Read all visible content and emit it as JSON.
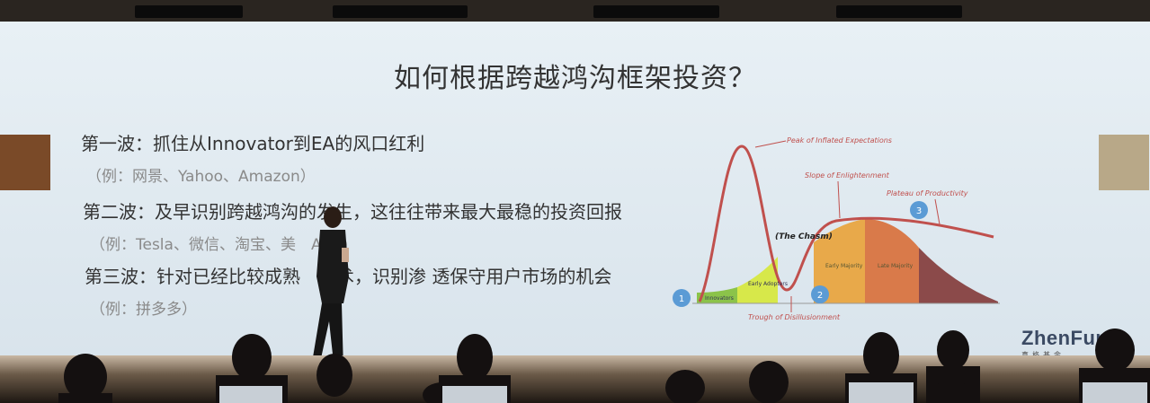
{
  "slide": {
    "title": "如何根据跨越鸿沟框架投资？",
    "waves": [
      {
        "text": "第一波：抓住从Innovator到EA的风口红利",
        "example": "（例：网景、Yahoo、Amazon）"
      },
      {
        "text": "第二波：及早识别跨越鸿沟的发生，这往往带来最大最稳的投资回报",
        "example": "（例：Tesla、微信、淘宝、美　AAS)"
      },
      {
        "text": "第三波：针对已经比较成熟　技术，识别渗 透保守用户市场的机会",
        "example": "（例：拼多多）"
      }
    ]
  },
  "chart": {
    "annotations": {
      "peak": "Peak of Inflated Expectations",
      "slope": "Slope of Enlightenment",
      "plateau": "Plateau of Productivity",
      "chasm": "(The Chasm)",
      "trough": "Trough of Disillusionment"
    },
    "segments": {
      "innovators": "Innovators",
      "early_adopters": "Early Adopters",
      "early_majority": "Early Majority",
      "late_majority": "Late Majority"
    },
    "markers": [
      "1",
      "2",
      "3"
    ]
  },
  "logo": {
    "name": "ZhenFund",
    "sub": "真格基金"
  },
  "colors": {
    "curve": "#c0504d",
    "innovators": "#8bc34a",
    "early_adopters": "#d7e84a",
    "early_majority": "#e8a94a",
    "late_majority": "#d97a4a",
    "laggards": "#8b4a4a",
    "marker": "#5b9bd5"
  }
}
